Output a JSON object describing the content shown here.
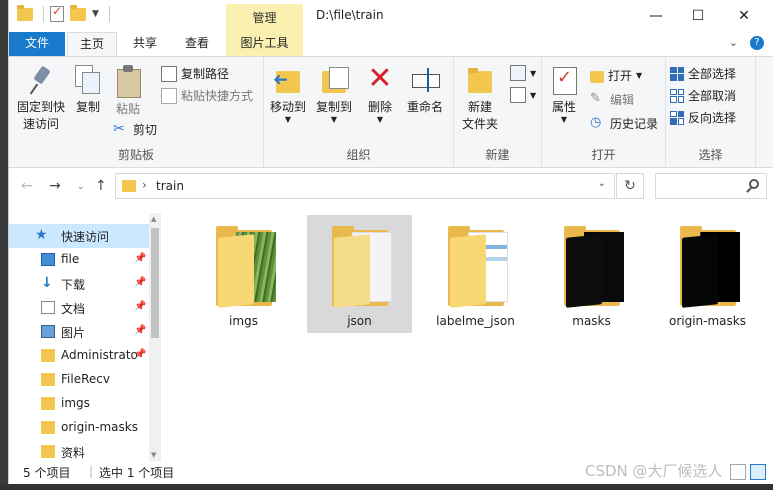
{
  "title": {
    "manage_tab": "管理",
    "path": "D:\\file\\train",
    "minimize": "—",
    "maximize": "☐",
    "close": "✕"
  },
  "tabs": [
    {
      "label": "文件"
    },
    {
      "label": "主页"
    },
    {
      "label": "共享"
    },
    {
      "label": "查看"
    },
    {
      "label": "图片工具"
    }
  ],
  "ribbon": {
    "clipboard": {
      "label": "剪贴板",
      "pin": "固定到快\n速访问",
      "pin_l1": "固定到快",
      "pin_l2": "速访问",
      "copy": "复制",
      "paste": "粘贴",
      "copy_path": "复制路径",
      "paste_shortcut": "粘贴快捷方式",
      "cut": "剪切"
    },
    "organize": {
      "label": "组织",
      "move_to": "移动到",
      "copy_to": "复制到",
      "delete": "删除",
      "rename": "重命名"
    },
    "new": {
      "label": "新建",
      "new_folder_l1": "新建",
      "new_folder_l2": "文件夹"
    },
    "open": {
      "label": "打开",
      "properties": "属性",
      "open": "打开",
      "edit": "编辑",
      "history": "历史记录"
    },
    "select": {
      "label": "选择",
      "select_all": "全部选择",
      "select_none": "全部取消",
      "invert": "反向选择"
    }
  },
  "address": {
    "crumb": "train",
    "search_placeholder": ""
  },
  "nav": {
    "items": [
      {
        "label": "快速访问",
        "icon": "star-icon",
        "selected": true,
        "pinned": false
      },
      {
        "label": "file",
        "icon": "desktop-icon",
        "selected": false,
        "pinned": true
      },
      {
        "label": "下载",
        "icon": "download-icon",
        "selected": false,
        "pinned": true
      },
      {
        "label": "文档",
        "icon": "document-icon",
        "selected": false,
        "pinned": true
      },
      {
        "label": "图片",
        "icon": "picture-icon",
        "selected": false,
        "pinned": true
      },
      {
        "label": "Administrato",
        "icon": "folder-icon",
        "selected": false,
        "pinned": true
      },
      {
        "label": "FileRecv",
        "icon": "folder-icon",
        "selected": false,
        "pinned": false
      },
      {
        "label": "imgs",
        "icon": "folder-icon",
        "selected": false,
        "pinned": false
      },
      {
        "label": "origin-masks",
        "icon": "folder-icon",
        "selected": false,
        "pinned": false
      },
      {
        "label": "资料",
        "icon": "folder-icon",
        "selected": false,
        "pinned": false
      }
    ]
  },
  "files": [
    {
      "name": "imgs",
      "preview": "green-image",
      "selected": false
    },
    {
      "name": "json",
      "preview": "white-document",
      "selected": true
    },
    {
      "name": "labelme_json",
      "preview": "labelme-document",
      "selected": false
    },
    {
      "name": "masks",
      "preview": "black-mask",
      "selected": false
    },
    {
      "name": "origin-masks",
      "preview": "black-mask",
      "selected": false
    }
  ],
  "status": {
    "count": "5 个项目",
    "selected": "选中 1 个项目"
  },
  "watermark": "CSDN @大厂候选人",
  "colors": {
    "accent": "#1979ca",
    "manage_tab": "#faf1b0",
    "selection": "#cce8ff",
    "folder": "#f3c74f"
  }
}
